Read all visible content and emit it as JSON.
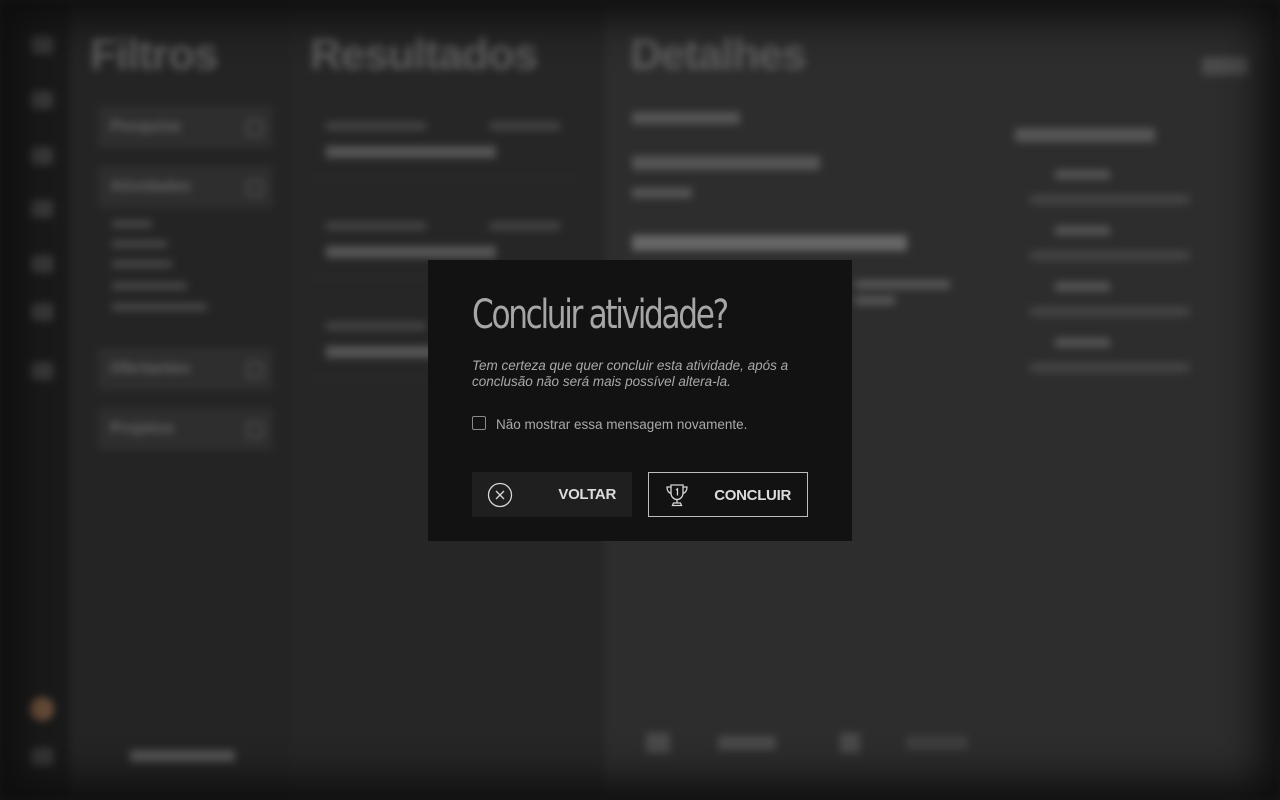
{
  "background": {
    "columns": [
      "Filtros",
      "Resultados",
      "Detalhes"
    ],
    "filter_boxes": [
      "Pesquisa",
      "Atividades",
      "Ofertantes",
      "Projetos"
    ]
  },
  "dialog": {
    "title": "Concluir atividade?",
    "message": "Tem certeza que quer concluir esta atividade, após a conclusão não será mais possível altera-la.",
    "checkbox_label": "Não mostrar essa mensagem novamente.",
    "checkbox_checked": false,
    "back_button": {
      "label": "VOLTAR",
      "icon": "circle-x-icon"
    },
    "confirm_button": {
      "label": "CONCLUIR",
      "icon": "trophy-icon"
    }
  },
  "colors": {
    "overlay_bg": "#161616",
    "dialog_bg": "#121212",
    "title_text": "#a6a6a6",
    "button_text": "#dcdcdc",
    "confirm_border": "#bdbdbd"
  }
}
